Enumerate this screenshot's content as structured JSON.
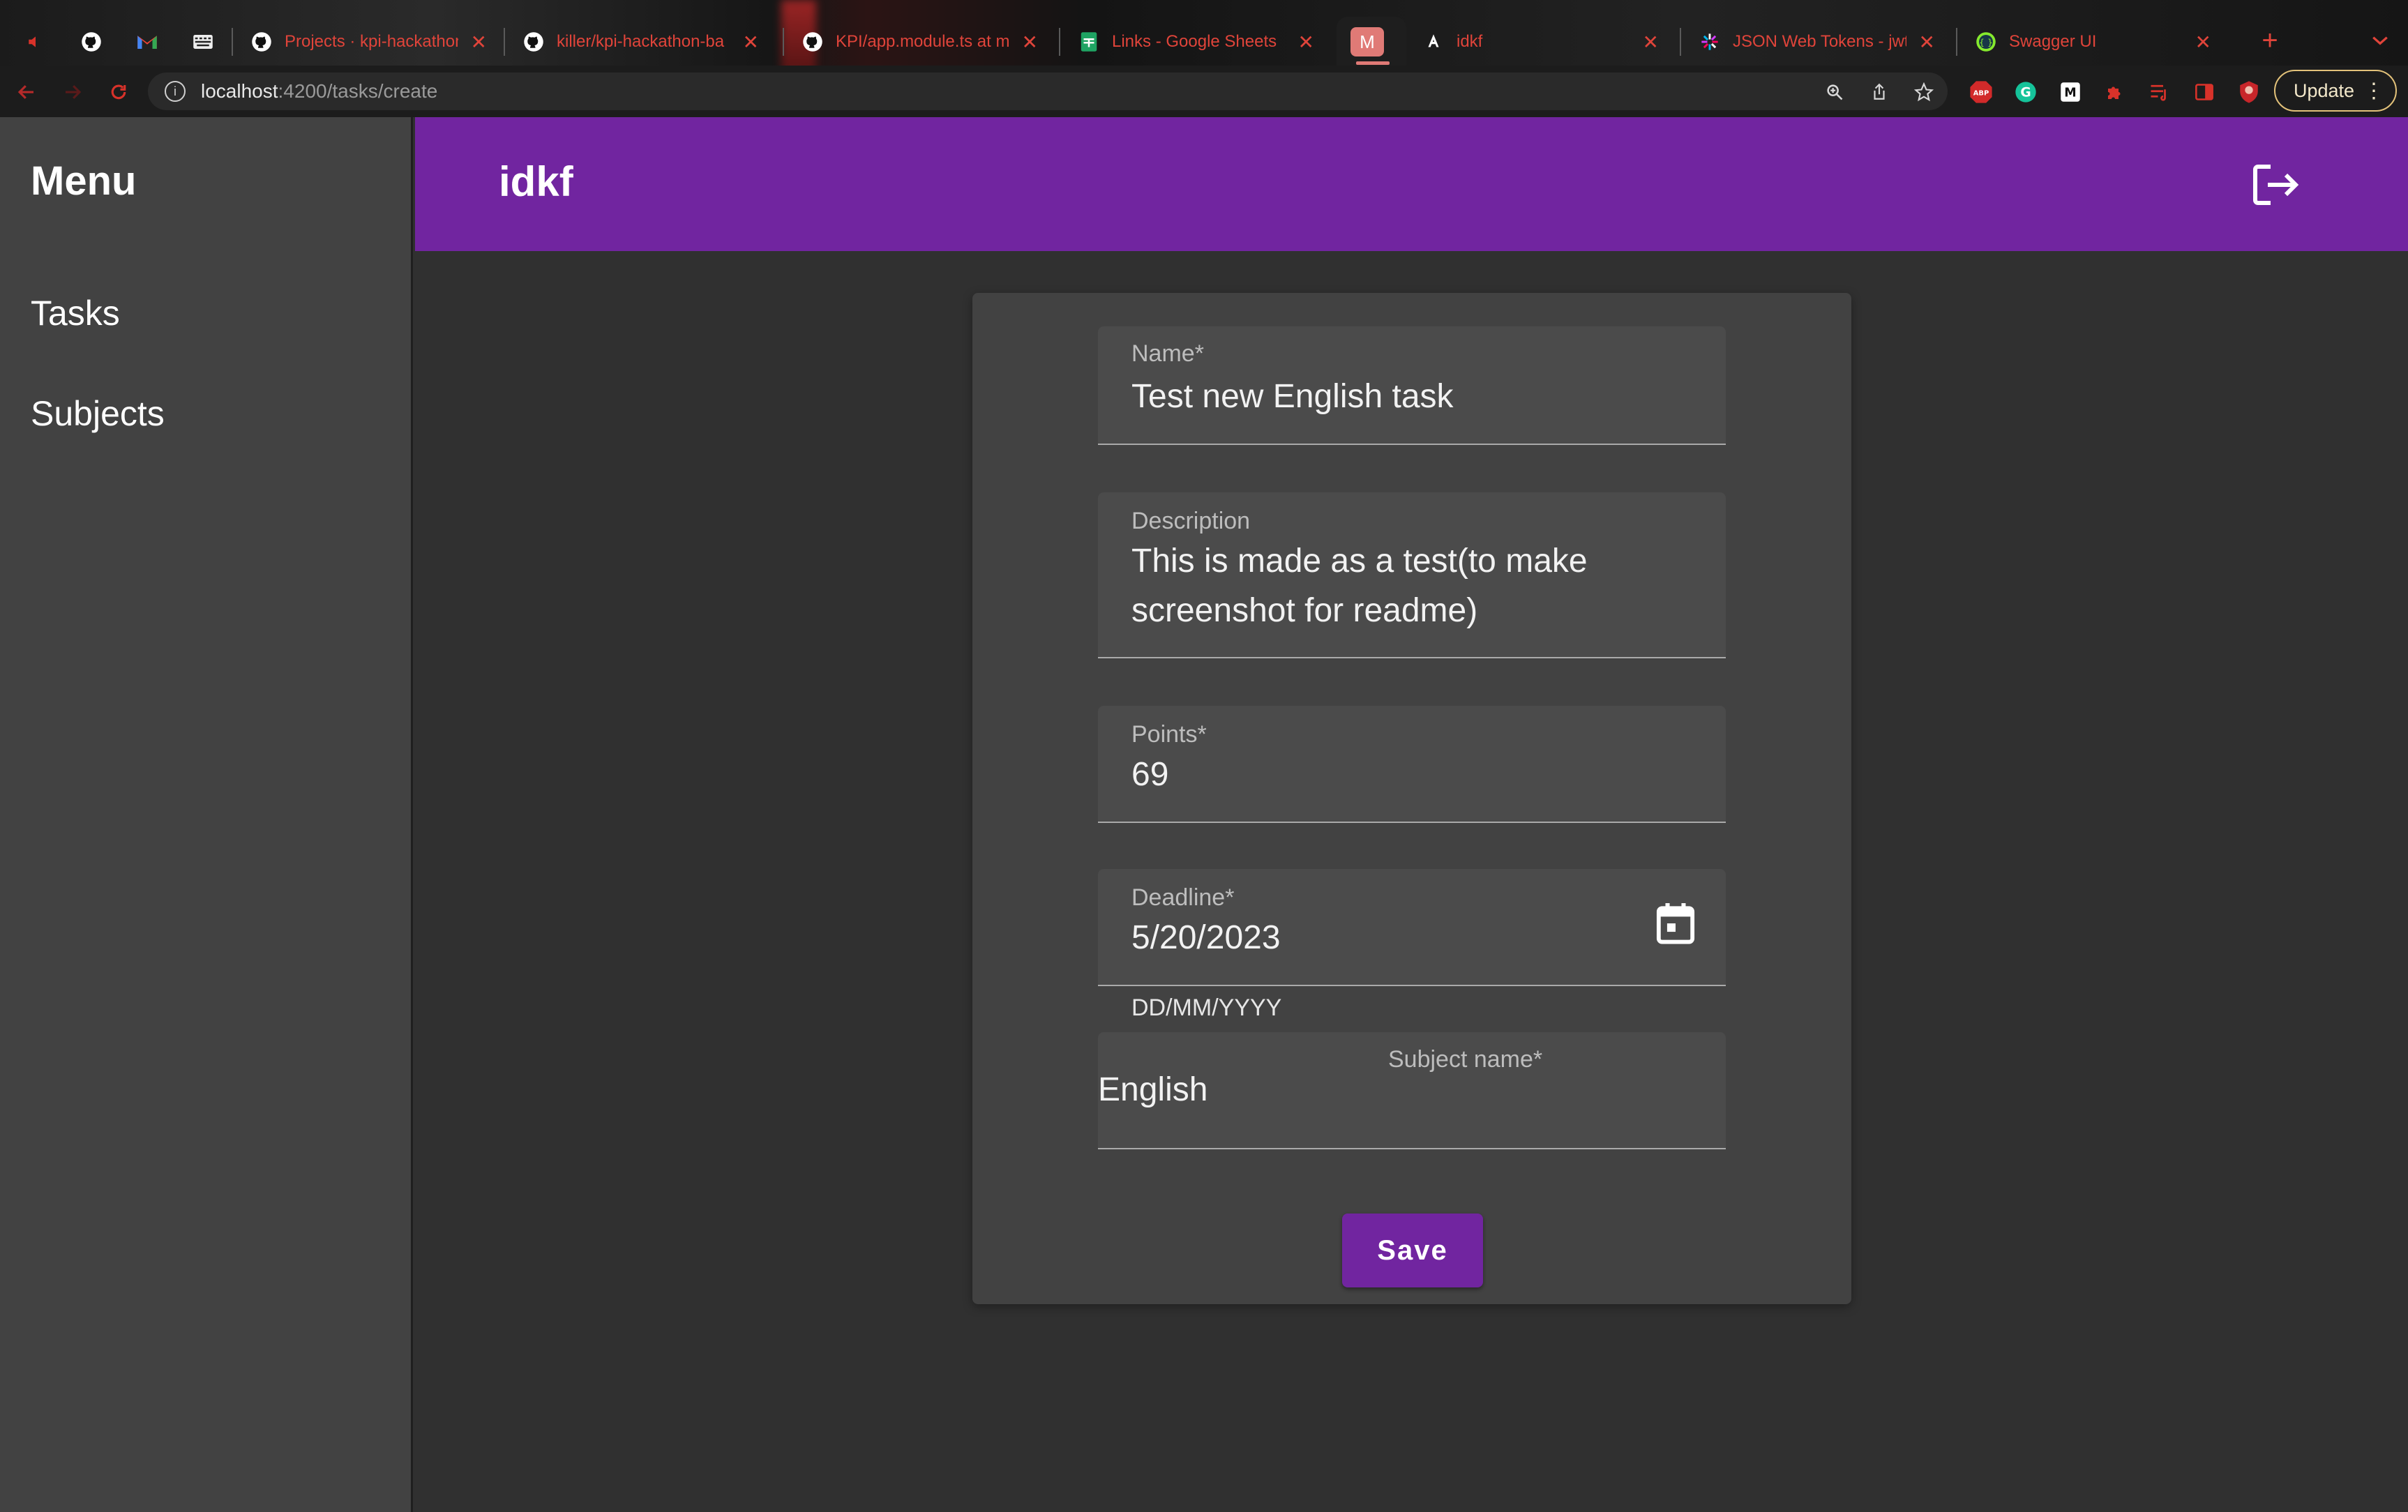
{
  "browser": {
    "tabs": [
      {
        "title": "",
        "icon": "speaker-icon"
      },
      {
        "title": "",
        "icon": "github-icon"
      },
      {
        "title": "",
        "icon": "gmail-icon"
      },
      {
        "title": "",
        "icon": "keyboard-icon"
      },
      {
        "title": "Projects · kpi-hackathon",
        "icon": "github-icon"
      },
      {
        "title": "killer/kpi-hackathon-ba",
        "icon": "github-icon"
      },
      {
        "title": "KPI/app.module.ts at m",
        "icon": "github-icon"
      },
      {
        "title": "Links - Google Sheets",
        "icon": "sheets-icon"
      },
      {
        "title": "",
        "icon": "m-app-icon"
      },
      {
        "title": "idkf",
        "icon": "angular-icon"
      },
      {
        "title": "JSON Web Tokens - jwt",
        "icon": "jwt-icon"
      },
      {
        "title": "Swagger UI",
        "icon": "swagger-icon"
      }
    ],
    "new_tab": "+",
    "address": {
      "host": "localhost",
      "path": ":4200/tasks/create"
    },
    "update_label": "Update",
    "ext_abp": "ABP"
  },
  "sidebar": {
    "title": "Menu",
    "items": [
      {
        "label": "Tasks"
      },
      {
        "label": "Subjects"
      }
    ]
  },
  "header": {
    "title": "idkf"
  },
  "form": {
    "name": {
      "label": "Name*",
      "value": "Test new English task"
    },
    "description": {
      "label": "Description",
      "value_line1": "This is made as a test(to make",
      "value_line2": "screenshot for readme)"
    },
    "points": {
      "label": "Points*",
      "value": "69"
    },
    "deadline": {
      "label": "Deadline*",
      "value": "5/20/2023",
      "hint": "DD/MM/YYYY"
    },
    "subject": {
      "label": "Subject name*",
      "value": "English"
    },
    "save_label": "Save"
  },
  "colors": {
    "accent": "#7125a0",
    "sidebar": "#424242",
    "background": "#303030",
    "card": "#424242"
  }
}
